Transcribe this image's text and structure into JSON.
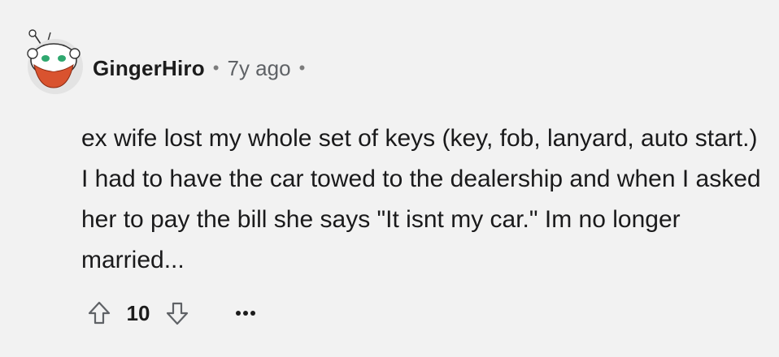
{
  "comment": {
    "username": "GingerHiro",
    "separator": "•",
    "timestamp": "7y ago",
    "body": "ex wife lost my whole set of keys (key, fob, lanyard, auto start.) I had to have the car towed to the dealership and when I asked her to pay the bill she says \"It isnt my car.\" Im no longer married...",
    "score": "10",
    "icons": {
      "avatar": "snoo-avatar",
      "upvote": "upvote-arrow-icon",
      "downvote": "downvote-arrow-icon",
      "more": "more-options-icon"
    },
    "colors": {
      "background": "#f2f2f2",
      "beard": "#d9532f",
      "eyes": "#2fa86f",
      "muted_text": "#5f6266"
    }
  }
}
